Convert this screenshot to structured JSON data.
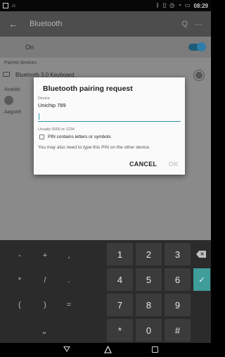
{
  "status_bar": {
    "time": "08:29",
    "icons_left": [
      "screenshot-icon",
      "image-icon"
    ],
    "icons_right": [
      "bluetooth-icon",
      "vibrate-icon",
      "alarm-icon",
      "wifi-icon",
      "battery-icon"
    ]
  },
  "toolbar": {
    "back_glyph": "←",
    "title": "Bluetooth",
    "search_glyph": "Q",
    "more_glyph": "⋯"
  },
  "toggle_row": {
    "label": "On",
    "state": "on"
  },
  "background_list": {
    "paired_header": "Paired devices",
    "paired_device": "Bluetooth 3.0 Keyboard",
    "available_header": "Availab",
    "other_header": "Aagrath"
  },
  "dialog": {
    "title": "Bluetooth pairing request",
    "device_label": "Device",
    "device_name": "Unichip 789",
    "pin_value": "",
    "pin_hint": "Usually 0000 or 1234",
    "checkbox_label": "PIN contains letters or symbols",
    "checkbox_checked": false,
    "extra_info": "You may also need to type this PIN on the other device.",
    "cancel_label": "CANCEL",
    "ok_label": "OK"
  },
  "keyboard": {
    "symbol_keys": [
      [
        "-",
        "+",
        ","
      ],
      [
        "*",
        "/",
        "."
      ],
      [
        "(",
        ")",
        "="
      ]
    ],
    "space_glyph": "⎵",
    "digit_rows": [
      [
        "1",
        "2",
        "3"
      ],
      [
        "4",
        "5",
        "6"
      ],
      [
        "7",
        "8",
        "9"
      ],
      [
        "*",
        "0",
        "#"
      ]
    ],
    "backspace_glyph": "✕",
    "enter_glyph": "✓"
  },
  "colors": {
    "accent": "#2795b3",
    "enter_key": "#3f9d9a",
    "toggle_on": "#2f7ea8"
  }
}
